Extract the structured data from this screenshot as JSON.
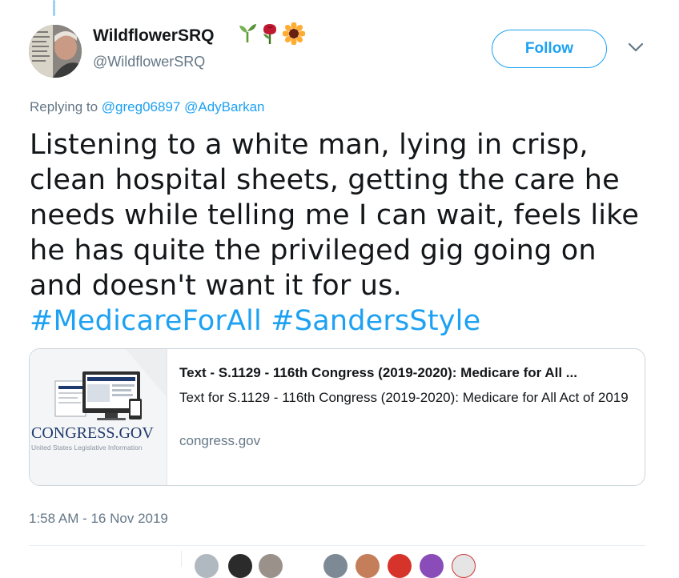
{
  "author": {
    "display_name": "WildflowerSRQ",
    "handle": "@WildflowerSRQ",
    "name_emojis": [
      "seedling-emoji",
      "rose-emoji",
      "sunflower-emoji"
    ]
  },
  "follow_button": {
    "label": "Follow"
  },
  "reply_context": {
    "prefix": "Replying to",
    "mentions": [
      "@greg06897",
      "@AdyBarkan"
    ]
  },
  "tweet": {
    "text": "Listening to a white man, lying in crisp, clean hospital sheets, getting the care he needs while telling me I can wait, feels like he has quite the privileged gig going on and doesn't want it for us.",
    "hashtags": [
      "#MedicareForAll",
      "#SandersStyle"
    ]
  },
  "link_card": {
    "title": "Text - S.1129 - 116th Congress (2019-2020): Medicare for All ...",
    "description": "Text for S.1129 - 116th Congress (2019-2020): Medicare for All Act of 2019",
    "domain": "congress.gov",
    "thumb_logo_text": "CONGRESS.GOV",
    "thumb_tagline": "United States Legislative Information"
  },
  "timestamp": "1:58 AM - 16 Nov 2019",
  "colors": {
    "accent": "#1da1f2",
    "secondary_text": "#657786",
    "border": "#ccd6dd",
    "congress_navy": "#1f3a6e"
  }
}
